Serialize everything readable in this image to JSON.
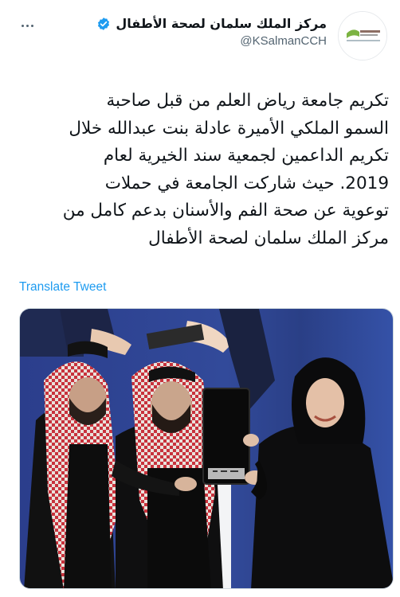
{
  "account": {
    "display_name": "مركز الملك سلمان لصحة الأطفال",
    "handle": "@KSalmanCCH",
    "verified": true
  },
  "icons": {
    "verified": "verified-badge-icon",
    "more": "more-options-icon",
    "avatar": "org-logo-avatar"
  },
  "tweet": {
    "text": "تكريم جامعة رياض العلم من قبل صاحبة\nالسمو الملكي الأميرة عادلة بنت عبدالله خلال\nتكريم الداعمين لجمعية سند الخيرية لعام\n2019. حيث شاركت الجامعة في حملات\nتوعوية عن صحة الفم والأسنان بدعم كامل من\nمركز الملك سلمان لصحة الأطفال",
    "translate_label": "Translate Tweet"
  },
  "media": {
    "type": "photo",
    "description": "award ceremony photo"
  },
  "colors": {
    "link": "#1d9bf0",
    "verified": "#1d9bf0",
    "text": "#0f1419",
    "secondary": "#536471"
  }
}
